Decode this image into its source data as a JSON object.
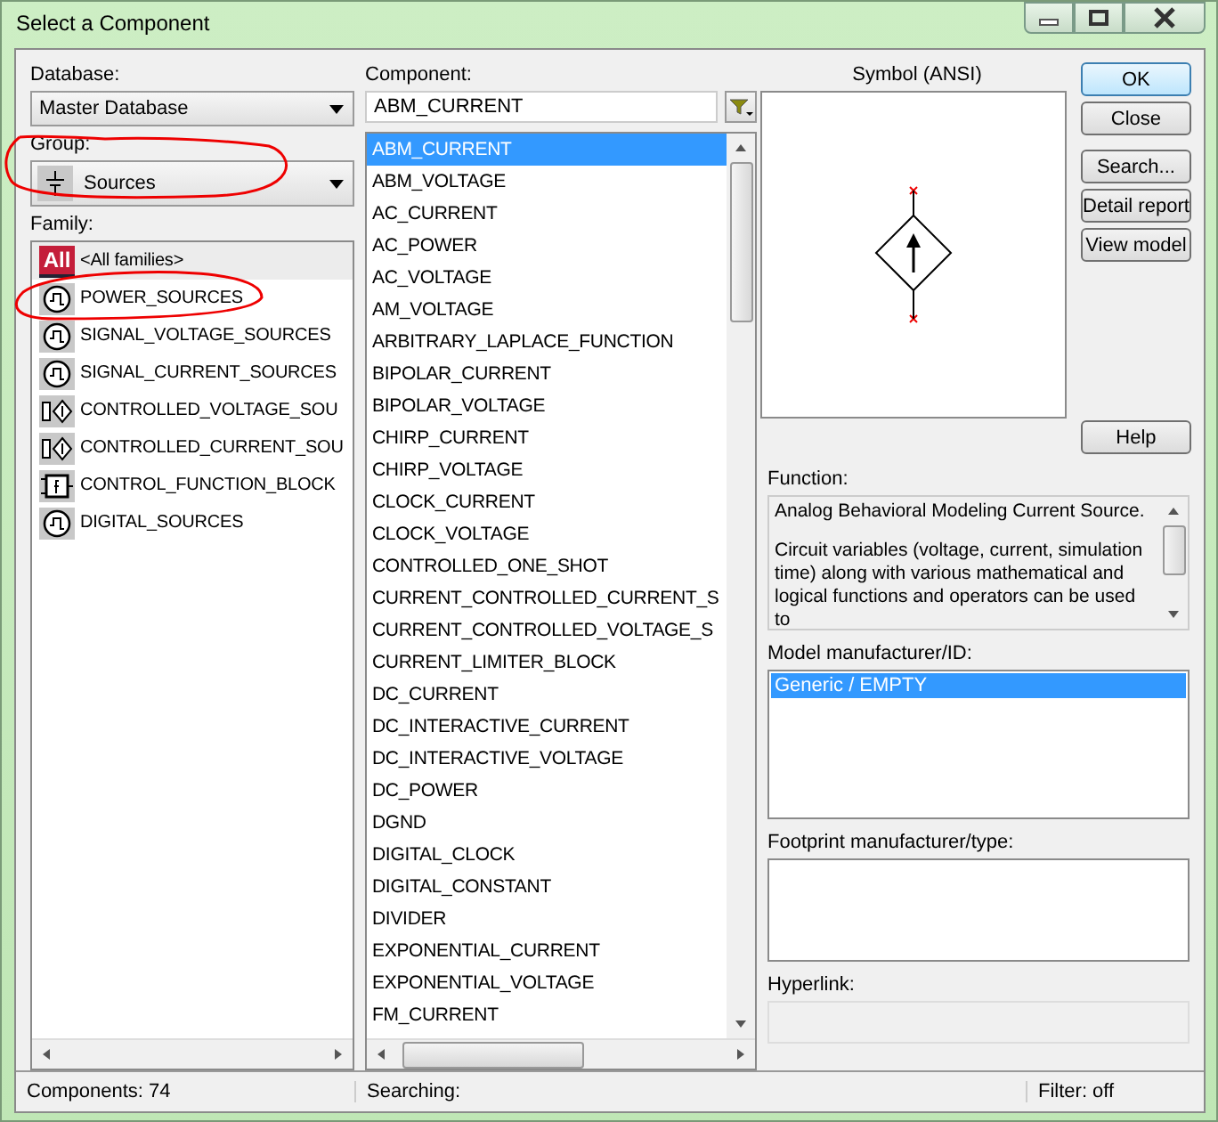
{
  "window": {
    "title": "Select a Component"
  },
  "database": {
    "label": "Database:",
    "value": "Master Database"
  },
  "group": {
    "label": "Group:",
    "value": "Sources"
  },
  "family": {
    "label": "Family:",
    "items": [
      {
        "icon_text": "All",
        "label": "<All families>",
        "selected": false,
        "kind": "all"
      },
      {
        "label": "POWER_SOURCES",
        "selected": false,
        "kind": "source"
      },
      {
        "label": "SIGNAL_VOLTAGE_SOURCES",
        "selected": false,
        "kind": "source"
      },
      {
        "label": "SIGNAL_CURRENT_SOURCES",
        "selected": false,
        "kind": "source"
      },
      {
        "label": "CONTROLLED_VOLTAGE_SOU",
        "selected": false,
        "kind": "controlled"
      },
      {
        "label": "CONTROLLED_CURRENT_SOU",
        "selected": false,
        "kind": "controlled"
      },
      {
        "label": "CONTROL_FUNCTION_BLOCK",
        "selected": false,
        "kind": "function"
      },
      {
        "label": "DIGITAL_SOURCES",
        "selected": false,
        "kind": "source"
      }
    ]
  },
  "component": {
    "label": "Component:",
    "value": "ABM_CURRENT",
    "items": [
      {
        "label": "ABM_CURRENT",
        "selected": true
      },
      {
        "label": "ABM_VOLTAGE",
        "selected": false
      },
      {
        "label": "AC_CURRENT",
        "selected": false
      },
      {
        "label": "AC_POWER",
        "selected": false
      },
      {
        "label": "AC_VOLTAGE",
        "selected": false
      },
      {
        "label": "AM_VOLTAGE",
        "selected": false
      },
      {
        "label": "ARBITRARY_LAPLACE_FUNCTION",
        "selected": false
      },
      {
        "label": "BIPOLAR_CURRENT",
        "selected": false
      },
      {
        "label": "BIPOLAR_VOLTAGE",
        "selected": false
      },
      {
        "label": "CHIRP_CURRENT",
        "selected": false
      },
      {
        "label": "CHIRP_VOLTAGE",
        "selected": false
      },
      {
        "label": "CLOCK_CURRENT",
        "selected": false
      },
      {
        "label": "CLOCK_VOLTAGE",
        "selected": false
      },
      {
        "label": "CONTROLLED_ONE_SHOT",
        "selected": false
      },
      {
        "label": "CURRENT_CONTROLLED_CURRENT_S",
        "selected": false
      },
      {
        "label": "CURRENT_CONTROLLED_VOLTAGE_S",
        "selected": false
      },
      {
        "label": "CURRENT_LIMITER_BLOCK",
        "selected": false
      },
      {
        "label": "DC_CURRENT",
        "selected": false
      },
      {
        "label": "DC_INTERACTIVE_CURRENT",
        "selected": false
      },
      {
        "label": "DC_INTERACTIVE_VOLTAGE",
        "selected": false
      },
      {
        "label": "DC_POWER",
        "selected": false
      },
      {
        "label": "DGND",
        "selected": false
      },
      {
        "label": "DIGITAL_CLOCK",
        "selected": false
      },
      {
        "label": "DIGITAL_CONSTANT",
        "selected": false
      },
      {
        "label": "DIVIDER",
        "selected": false
      },
      {
        "label": "EXPONENTIAL_CURRENT",
        "selected": false
      },
      {
        "label": "EXPONENTIAL_VOLTAGE",
        "selected": false
      },
      {
        "label": "FM_CURRENT",
        "selected": false
      }
    ]
  },
  "symbol": {
    "label": "Symbol (ANSI)"
  },
  "buttons": [
    "OK",
    "Close",
    "Search...",
    "Detail report",
    "View model",
    "Help"
  ],
  "function": {
    "label": "Function:",
    "paragraphs": [
      "Analog Behavioral Modeling Current Source.",
      "Circuit variables (voltage, current, simulation time) along with various mathematical and logical functions and operators can be used to"
    ]
  },
  "model": {
    "label": "Model manufacturer/ID:",
    "items": [
      {
        "label": "Generic / EMPTY",
        "selected": true
      }
    ]
  },
  "footprint": {
    "label": "Footprint manufacturer/type:"
  },
  "hyperlink": {
    "label": "Hyperlink:"
  },
  "status_bar": [
    "Components: 74",
    "Searching:",
    "Filter: off"
  ]
}
